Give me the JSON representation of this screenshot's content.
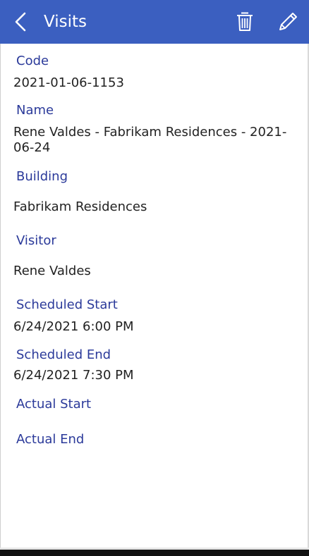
{
  "header": {
    "title": "Visits",
    "back_icon": "chevron-left-icon",
    "delete_icon": "trash-icon",
    "edit_icon": "pencil-icon",
    "color": "#3b5fc0"
  },
  "fields": {
    "code": {
      "label": "Code",
      "value": "2021-01-06-1153"
    },
    "name": {
      "label": "Name",
      "value": "Rene Valdes - Fabrikam Residences - 2021-06-24"
    },
    "building": {
      "label": "Building",
      "value": "Fabrikam Residences"
    },
    "visitor": {
      "label": "Visitor",
      "value": "Rene Valdes"
    },
    "scheduled_start": {
      "label": "Scheduled Start",
      "value": "6/24/2021 6:00 PM"
    },
    "scheduled_end": {
      "label": "Scheduled End",
      "value": "6/24/2021 7:30 PM"
    },
    "actual_start": {
      "label": "Actual Start",
      "value": ""
    },
    "actual_end": {
      "label": "Actual End",
      "value": ""
    }
  },
  "colors": {
    "label": "#2b3a9a",
    "value": "#222222"
  }
}
